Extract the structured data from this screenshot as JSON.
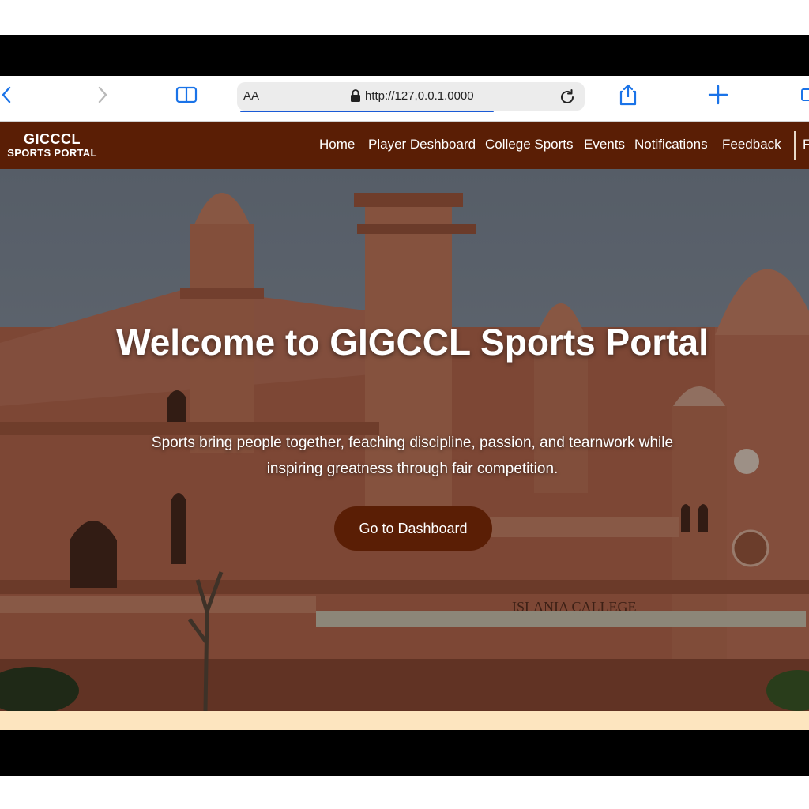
{
  "browser": {
    "text_size_label": "AA",
    "url": "http://127,0.0.1.0000",
    "accent_color": "#1a73e8"
  },
  "site": {
    "brand_title": "GICCCL",
    "brand_subtitle": "SPORTS PORTAL",
    "nav_color": "#5a1e05",
    "menu": [
      {
        "label": "Home"
      },
      {
        "label": "Player Deshboard"
      },
      {
        "label": "College Sports"
      },
      {
        "label": "Events"
      },
      {
        "label": "Notifications"
      },
      {
        "label": "Feedback"
      }
    ],
    "menu_overflow": "F"
  },
  "hero": {
    "title": "Welcome to GIGCCL Sports Portal",
    "subtitle": "Sports bring people together, feaching discipline, passion, and tearnwork while inspiring greatness through fair competition.",
    "button_label": "Go to Dashboard",
    "inscription": "ISLANIA CALLEGE"
  }
}
